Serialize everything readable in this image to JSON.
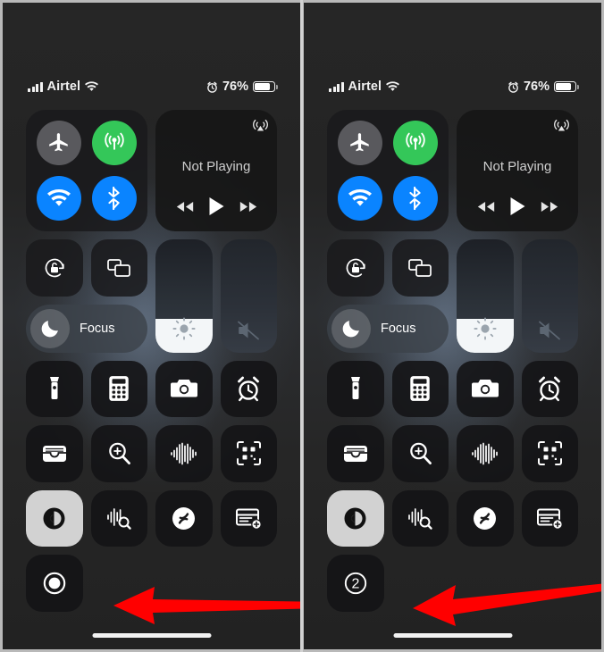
{
  "screenshot": {
    "title": "iOS Control Center screen recording",
    "panel_count": 2,
    "divider_color": "#d2d2d2"
  },
  "status_bar": {
    "carrier": "Airtel",
    "signal_icon": "cellular-bars-icon",
    "wifi_icon": "wifi-icon",
    "alarm_icon": "alarm-clock-icon",
    "battery_percent": "76%",
    "battery_level": 76,
    "battery_icon": "battery-icon"
  },
  "connectivity": {
    "airplane": {
      "label": "Airplane Mode",
      "icon": "airplane-icon",
      "state": "off",
      "color": "#59595d"
    },
    "cellular": {
      "label": "Cellular Data",
      "icon": "cellular-data-icon",
      "state": "on",
      "color": "#34c759"
    },
    "wifi": {
      "label": "Wi-Fi",
      "icon": "wifi-icon",
      "state": "on",
      "color": "#0a84ff"
    },
    "bluetooth": {
      "label": "Bluetooth",
      "icon": "bluetooth-icon",
      "state": "on",
      "color": "#0a84ff"
    }
  },
  "media": {
    "title": "Not Playing",
    "airplay_icon": "airplay-audio-icon",
    "rewind_icon": "rewind-icon",
    "play_icon": "play-icon",
    "forward_icon": "fast-forward-icon"
  },
  "controls": {
    "rotation_lock": {
      "label": "Rotation Lock",
      "icon": "rotation-lock-icon"
    },
    "screen_mirroring": {
      "label": "Screen Mirroring",
      "icon": "screen-mirroring-icon"
    },
    "focus": {
      "label": "Focus",
      "icon": "moon-icon"
    },
    "brightness": {
      "label": "Brightness",
      "icon": "brightness-sun-icon",
      "value": 30
    },
    "volume": {
      "label": "Volume",
      "icon": "speaker-mute-icon",
      "value": 0
    }
  },
  "tiles": [
    {
      "name": "flashlight",
      "label": "Flashlight",
      "icon": "flashlight-icon",
      "active": false
    },
    {
      "name": "calculator",
      "label": "Calculator",
      "icon": "calculator-icon",
      "active": false
    },
    {
      "name": "camera",
      "label": "Camera",
      "icon": "camera-icon",
      "active": false
    },
    {
      "name": "timer",
      "label": "Timer",
      "icon": "alarm-clock-icon",
      "active": false
    },
    {
      "name": "wallet",
      "label": "Wallet",
      "icon": "wallet-icon",
      "active": false
    },
    {
      "name": "magnifier",
      "label": "Magnifier",
      "icon": "magnifier-icon",
      "active": false
    },
    {
      "name": "hearing",
      "label": "Hearing",
      "icon": "sound-waveform-icon",
      "active": false
    },
    {
      "name": "code-scanner",
      "label": "Code Scanner",
      "icon": "qr-scanner-icon",
      "active": false
    },
    {
      "name": "dark-mode",
      "label": "Dark Mode",
      "icon": "dark-mode-icon",
      "active": true
    },
    {
      "name": "sound-recognition",
      "label": "Sound Recognition",
      "icon": "sound-recognition-icon",
      "active": false
    },
    {
      "name": "shazam",
      "label": "Music Recognition",
      "icon": "shazam-icon",
      "active": false
    },
    {
      "name": "quick-note",
      "label": "Quick Note",
      "icon": "quick-note-icon",
      "active": false
    }
  ],
  "screen_record": {
    "left_panel": {
      "label": "Screen Recording",
      "icon": "record-button-icon",
      "state": "idle"
    },
    "right_panel": {
      "label": "Screen Recording countdown",
      "icon": "countdown-ring-icon",
      "countdown": "2",
      "state": "counting-down"
    }
  },
  "annotations": {
    "arrow_color": "#ff0000",
    "left_arrow": {
      "name": "callout-arrow-record-button",
      "points_to": "Screen Recording button"
    },
    "right_arrow": {
      "name": "callout-arrow-countdown",
      "points_to": "Screen Recording countdown"
    }
  }
}
